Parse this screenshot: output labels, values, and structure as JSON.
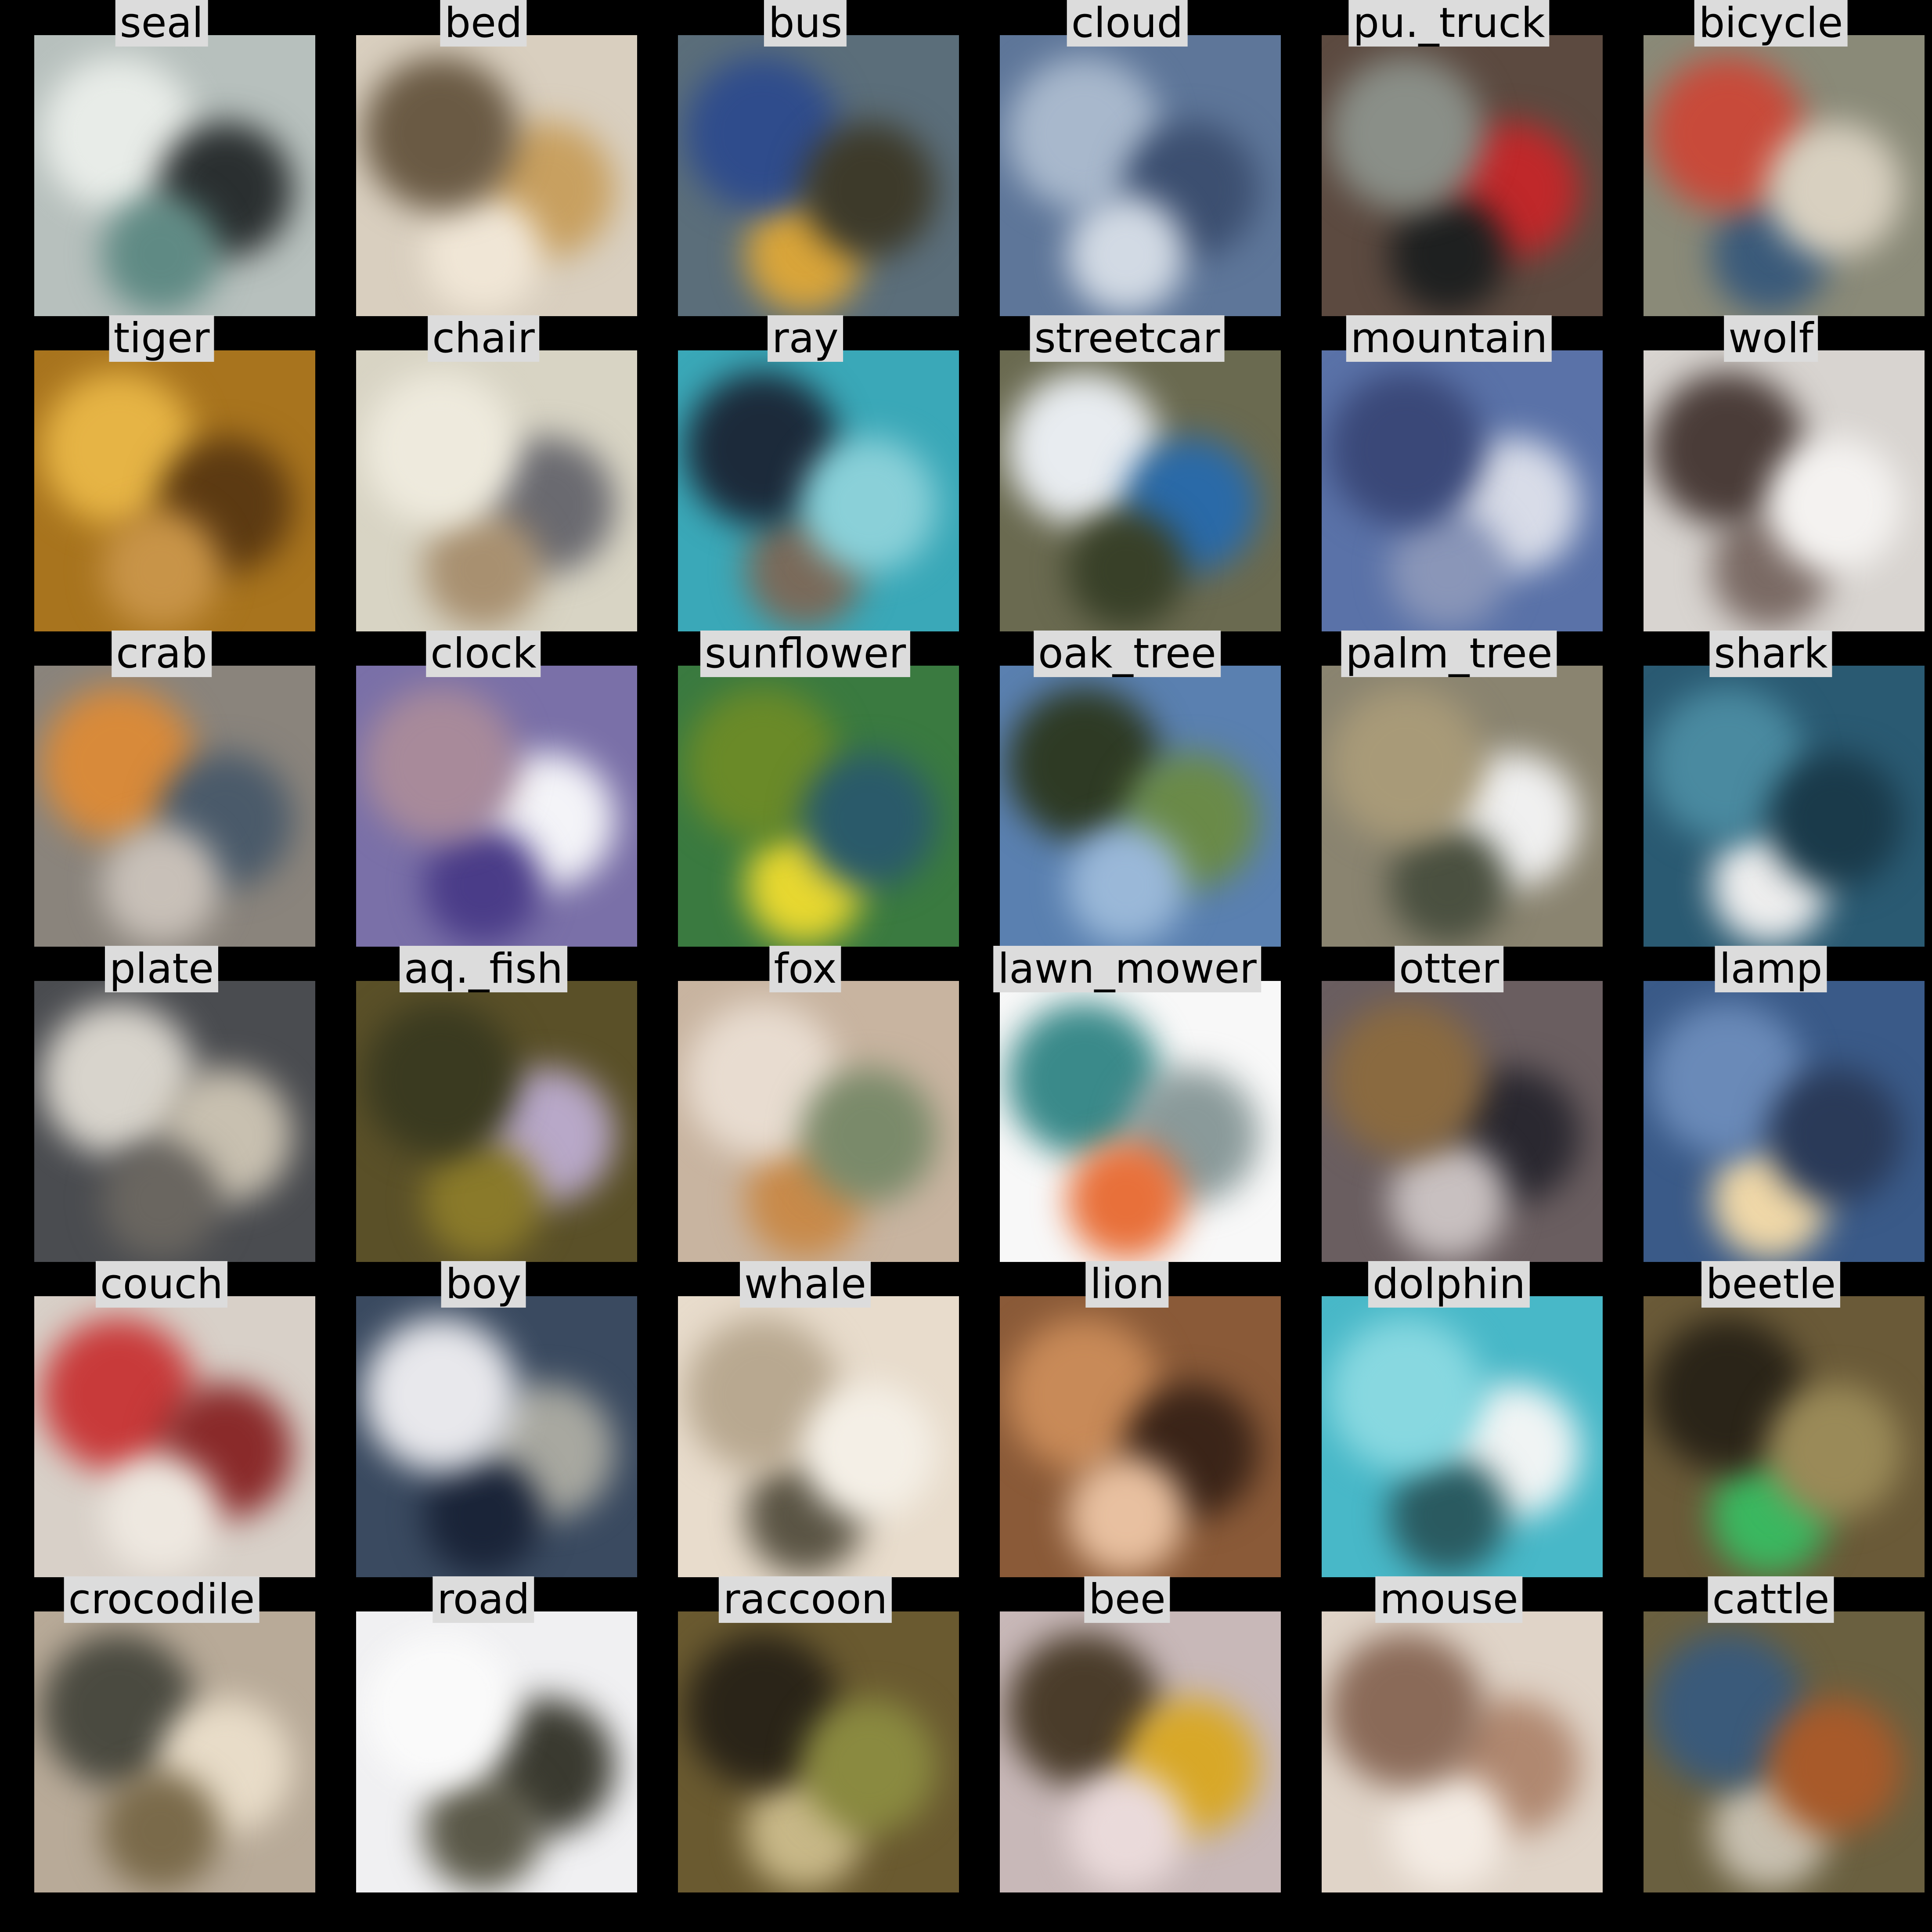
{
  "tiles": [
    {
      "label": "seal",
      "bg": "#b7c0bd",
      "accents": [
        "#e8ece8",
        "#2a2f30",
        "#5f8a84"
      ]
    },
    {
      "label": "bed",
      "bg": "#d9cfbf",
      "accents": [
        "#c8a060",
        "#f0e6d6",
        "#6a5a44"
      ]
    },
    {
      "label": "bus",
      "bg": "#5b6e7a",
      "accents": [
        "#d9a53a",
        "#2f4c8c",
        "#3d3a2a"
      ]
    },
    {
      "label": "cloud",
      "bg": "#5e7699",
      "accents": [
        "#a8b8cc",
        "#3c4f70",
        "#d2dae4"
      ]
    },
    {
      "label": "pu._truck",
      "bg": "#5c4a40",
      "accents": [
        "#c0282a",
        "#1e2020",
        "#8a8f88"
      ]
    },
    {
      "label": "bicycle",
      "bg": "#8a8a78",
      "accents": [
        "#3a5a7a",
        "#c84a3a",
        "#d8d0c0"
      ]
    },
    {
      "label": "tiger",
      "bg": "#a8741e",
      "accents": [
        "#e6b445",
        "#5c3a12",
        "#c89448"
      ]
    },
    {
      "label": "chair",
      "bg": "#d8d4c4",
      "accents": [
        "#6a6a70",
        "#a89070",
        "#eeeadd"
      ]
    },
    {
      "label": "ray",
      "bg": "#3aa8b8",
      "accents": [
        "#7a6a5a",
        "#1c2a3a",
        "#8ad0d8"
      ]
    },
    {
      "label": "streetcar",
      "bg": "#6a6a50",
      "accents": [
        "#e8ecf0",
        "#2a6aa8",
        "#384028"
      ]
    },
    {
      "label": "mountain",
      "bg": "#5a72a8",
      "accents": [
        "#d8dce8",
        "#8a96b8",
        "#3a4878"
      ]
    },
    {
      "label": "wolf",
      "bg": "#d8d4d0",
      "accents": [
        "#7a6a64",
        "#4a3c38",
        "#f4f2f0"
      ]
    },
    {
      "label": "crab",
      "bg": "#8a847c",
      "accents": [
        "#d88a3a",
        "#4a5a6a",
        "#c8c0b8"
      ]
    },
    {
      "label": "clock",
      "bg": "#7a70a8",
      "accents": [
        "#f4f4f8",
        "#4a3c88",
        "#a88a9a"
      ]
    },
    {
      "label": "sunflower",
      "bg": "#3a7a40",
      "accents": [
        "#e8d830",
        "#6a8a28",
        "#2a5a6a"
      ]
    },
    {
      "label": "oak_tree",
      "bg": "#5a80b0",
      "accents": [
        "#2e3a24",
        "#6a8a48",
        "#9ab8d8"
      ]
    },
    {
      "label": "palm_tree",
      "bg": "#8a8470",
      "accents": [
        "#f0f0f0",
        "#4a5040",
        "#a89a78"
      ]
    },
    {
      "label": "shark",
      "bg": "#2a5a72",
      "accents": [
        "#eeeeee",
        "#4a8aa0",
        "#1a3a4a"
      ]
    },
    {
      "label": "plate",
      "bg": "#4a4c50",
      "accents": [
        "#d8d4cc",
        "#c8c0b0",
        "#6a6660"
      ]
    },
    {
      "label": "aq._fish",
      "bg": "#5a5028",
      "accents": [
        "#b8a8c8",
        "#8a7a2a",
        "#3a3a20"
      ]
    },
    {
      "label": "fox",
      "bg": "#c8b4a0",
      "accents": [
        "#c88a4a",
        "#e8dcd0",
        "#7a8a6a"
      ]
    },
    {
      "label": "lawn_mower",
      "bg": "#f8f8f8",
      "accents": [
        "#3a8a8a",
        "#8a9a9a",
        "#e8703a"
      ]
    },
    {
      "label": "otter",
      "bg": "#6a5e60",
      "accents": [
        "#2a2830",
        "#c8c0c0",
        "#8a6a40"
      ]
    },
    {
      "label": "lamp",
      "bg": "#3a5a88",
      "accents": [
        "#f0d8a8",
        "#6a8ab8",
        "#2a3a58"
      ]
    },
    {
      "label": "couch",
      "bg": "#d8d0c8",
      "accents": [
        "#c83a3a",
        "#8a2a2a",
        "#eee8e0"
      ]
    },
    {
      "label": "boy",
      "bg": "#3a4a60",
      "accents": [
        "#a8a8a0",
        "#1a2438",
        "#e8e8ec"
      ]
    },
    {
      "label": "whale",
      "bg": "#e8dccc",
      "accents": [
        "#5a5444",
        "#b8a890",
        "#f4efe6"
      ]
    },
    {
      "label": "lion",
      "bg": "#8a5a38",
      "accents": [
        "#c88a58",
        "#3a2418",
        "#e8c0a0"
      ]
    },
    {
      "label": "dolphin",
      "bg": "#48b8c8",
      "accents": [
        "#f0f4f4",
        "#2a5a60",
        "#88d8e0"
      ]
    },
    {
      "label": "beetle",
      "bg": "#6a5a38",
      "accents": [
        "#3ab860",
        "#2a2418",
        "#9a8a58"
      ]
    },
    {
      "label": "crocodile",
      "bg": "#b8aa98",
      "accents": [
        "#4a4a40",
        "#e8dcc8",
        "#7a6a4a"
      ]
    },
    {
      "label": "road",
      "bg": "#f0f0f2",
      "accents": [
        "#3a3a30",
        "#5a5848",
        "#fafafa"
      ]
    },
    {
      "label": "raccoon",
      "bg": "#6a5a30",
      "accents": [
        "#c8b888",
        "#2a2418",
        "#8a8a40"
      ]
    },
    {
      "label": "bee",
      "bg": "#c8b8b8",
      "accents": [
        "#4a3c2a",
        "#d8a828",
        "#eadada"
      ]
    },
    {
      "label": "mouse",
      "bg": "#e0d4c8",
      "accents": [
        "#b08870",
        "#f4ece4",
        "#8a6a58"
      ]
    },
    {
      "label": "cattle",
      "bg": "#6a6040",
      "accents": [
        "#c8c0b0",
        "#3a5a7a",
        "#a85a2a"
      ]
    }
  ]
}
